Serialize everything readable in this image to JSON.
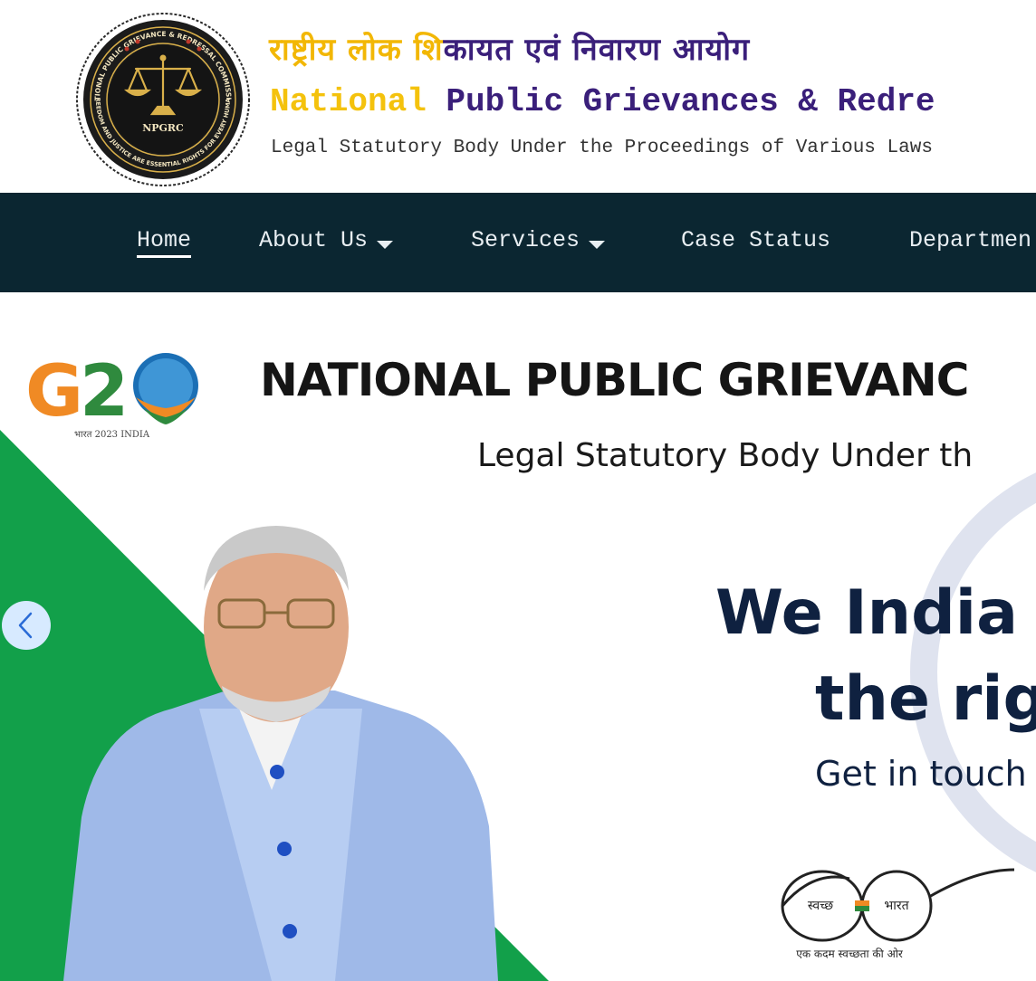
{
  "header": {
    "seal_abbrev": "NPGRC",
    "seal_ring_text": "NATIONAL PUBLIC GRIEVANCE & REDRESSAL COMMISSION",
    "seal_motto": "FREEDOM AND JUSTICE ARE ESSENTIAL RIGHTS FOR EVERY HUMAN",
    "title_hindi_accent": "राष्ट्रीय लोक शि",
    "title_hindi_rest": "कायत एवं निवारण आयोग",
    "title_english_accent": "National",
    "title_english_rest": " Public Grievances & Redre",
    "subtitle": "Legal Statutory Body Under the Proceedings of Various Laws"
  },
  "nav": {
    "items": [
      {
        "label": "Home"
      },
      {
        "label": "About Us"
      },
      {
        "label": "Services"
      },
      {
        "label": "Case Status"
      },
      {
        "label": "Departmen"
      }
    ]
  },
  "hero": {
    "g20_caption": "भारत 2023 INDIA",
    "title": "NATIONAL PUBLIC GRIEVANC",
    "subtitle": "Legal Statutory Body Under th",
    "headline_line1": "We India",
    "headline_line2": "the rig",
    "cta_text": "Get in touch",
    "swachh_left": "स्वच्छ",
    "swachh_right": "भारत",
    "swachh_tagline": "एक कदम स्वच्छता की ओर"
  },
  "colors": {
    "nav_bg": "#0b2631",
    "brand_purple": "#3a1f7a",
    "brand_yellow": "#f4c20d",
    "hero_green": "#12a04a",
    "navy_text": "#0f2140"
  },
  "icons": {
    "prev": "chevron-left-icon",
    "dropdown": "caret-down-icon"
  }
}
